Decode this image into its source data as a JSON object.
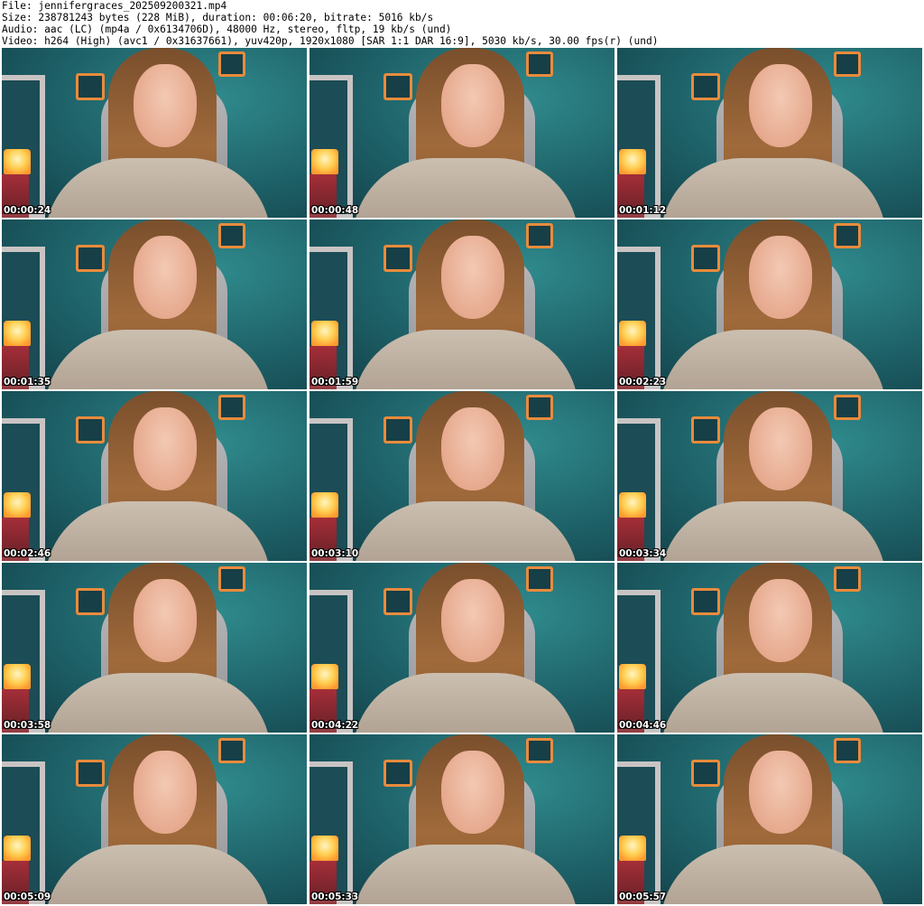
{
  "header": {
    "file": "File: jennifergraces_202509200321.mp4",
    "size": "Size: 238781243 bytes (228 MiB), duration: 00:06:20, bitrate: 5016 kb/s",
    "audio": "Audio: aac (LC) (mp4a / 0x6134706D), 48000 Hz, stereo, fltp, 19 kb/s (und)",
    "video": "Video: h264 (High) (avc1 / 0x31637661), yuv420p, 1920x1080 [SAR 1:1 DAR 16:9], 5030 kb/s, 30.00 fps(r) (und)"
  },
  "thumbnails": [
    {
      "time": "00:00:24"
    },
    {
      "time": "00:00:48"
    },
    {
      "time": "00:01:12"
    },
    {
      "time": "00:01:35"
    },
    {
      "time": "00:01:59"
    },
    {
      "time": "00:02:23"
    },
    {
      "time": "00:02:46"
    },
    {
      "time": "00:03:10"
    },
    {
      "time": "00:03:34"
    },
    {
      "time": "00:03:58"
    },
    {
      "time": "00:04:22"
    },
    {
      "time": "00:04:46"
    },
    {
      "time": "00:05:09"
    },
    {
      "time": "00:05:33"
    },
    {
      "time": "00:05:57"
    }
  ]
}
